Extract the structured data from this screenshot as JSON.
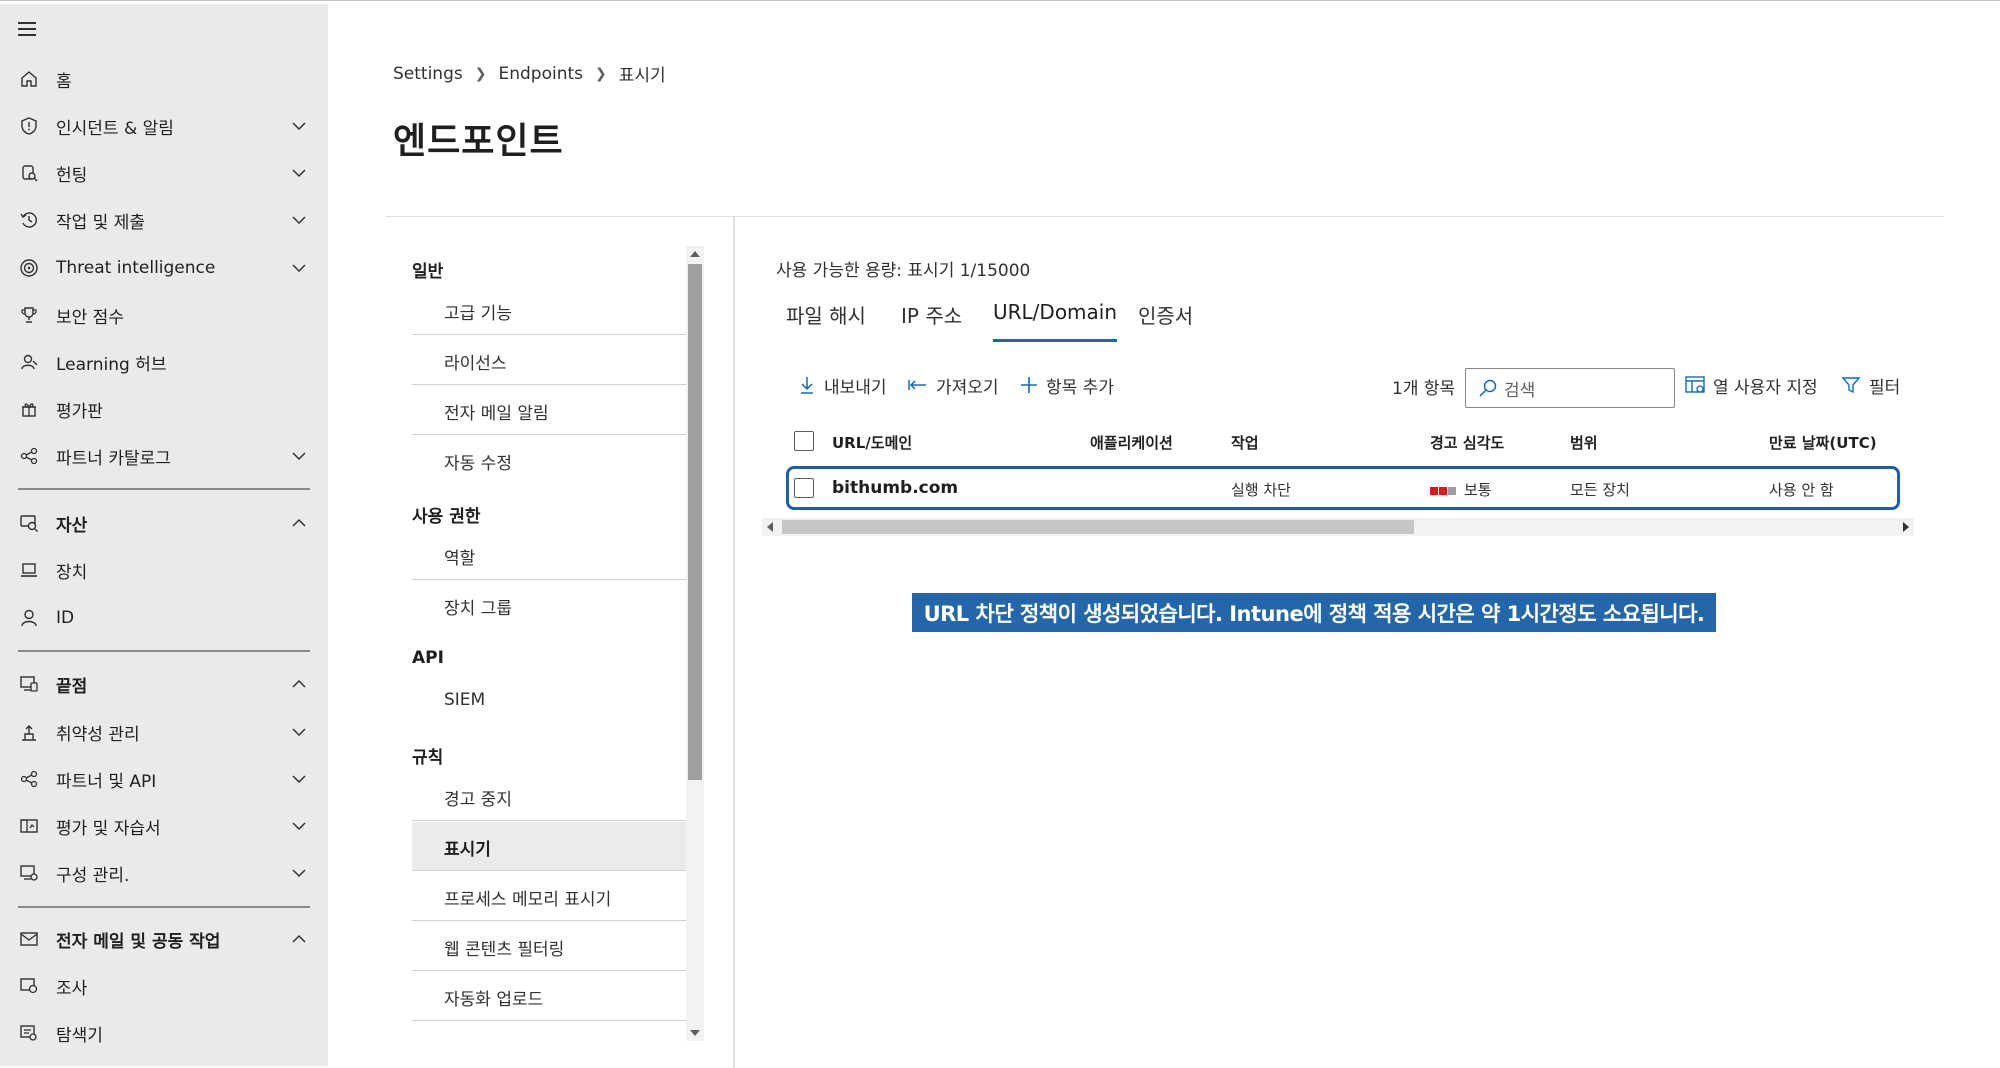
{
  "nav": {
    "items": [
      {
        "label": "홈",
        "icon": "home-icon"
      },
      {
        "label": "인시던트 & 알림",
        "icon": "shield-icon",
        "chevron": "down"
      },
      {
        "label": "헌팅",
        "icon": "hunting-icon",
        "chevron": "down"
      },
      {
        "label": "작업 및 제출",
        "icon": "actions-icon",
        "chevron": "down"
      },
      {
        "label": "Threat intelligence",
        "icon": "threat-intel-icon",
        "chevron": "down"
      },
      {
        "label": "보안 점수",
        "icon": "trophy-icon"
      },
      {
        "label": "Learning 허브",
        "icon": "learning-hub-icon"
      },
      {
        "label": "평가판",
        "icon": "trials-icon"
      },
      {
        "label": "파트너 카탈로그",
        "icon": "partner-icon",
        "chevron": "down"
      },
      {
        "label": "자산",
        "icon": "assets-icon",
        "chevron": "up"
      },
      {
        "label": "장치",
        "icon": "laptop-icon"
      },
      {
        "label": "ID",
        "icon": "person-icon"
      },
      {
        "label": "끝점",
        "icon": "endpoints-icon",
        "chevron": "up"
      },
      {
        "label": "취약성 관리",
        "icon": "vulnerability-icon",
        "chevron": "down"
      },
      {
        "label": "파트너 및 API",
        "icon": "partner-api-icon",
        "chevron": "down"
      },
      {
        "label": "평가 및 자습서",
        "icon": "evaluation-icon",
        "chevron": "down"
      },
      {
        "label": "구성 관리.",
        "icon": "config-icon",
        "chevron": "down"
      },
      {
        "label": "전자 메일 및 공동 작업",
        "icon": "mail-icon",
        "chevron": "up"
      },
      {
        "label": "조사",
        "icon": "investigation-icon"
      },
      {
        "label": "탐색기",
        "icon": "explorer-icon"
      }
    ]
  },
  "breadcrumb": {
    "items": [
      "Settings",
      "Endpoints",
      "표시기"
    ]
  },
  "page_title": "엔드포인트",
  "settings_nav": {
    "groups": [
      {
        "label": "일반",
        "items": [
          "고급 기능",
          "라이선스",
          "전자 메일 알림",
          "자동 수정"
        ]
      },
      {
        "label": "사용 권한",
        "items": [
          "역할",
          "장치 그룹"
        ]
      },
      {
        "label": "API",
        "items": [
          "SIEM"
        ]
      },
      {
        "label": "규칙",
        "items": [
          "경고 중지",
          "표시기",
          "프로세스 메모리 표시기",
          "웹 콘텐츠 필터링",
          "자동화 업로드"
        ]
      }
    ],
    "active": "표시기"
  },
  "capacity": "사용 가능한 용량: 표시기 1/15000",
  "tabs": [
    "파일 해시",
    "IP 주소",
    "URL/Domain",
    "인증서"
  ],
  "active_tab": "URL/Domain",
  "toolbar": {
    "export": "내보내기",
    "import": "가져오기",
    "add": "항목 추가",
    "count": "1개 항목",
    "search_placeholder": "검색",
    "customize_columns": "열 사용자 지정",
    "filter": "필터"
  },
  "table": {
    "headers": [
      "URL/도메인",
      "애플리케이션",
      "작업",
      "경고 심각도",
      "범위",
      "만료 날짜(UTC)"
    ],
    "rows": [
      {
        "url": "bithumb.com",
        "application": "",
        "action": "실행 차단",
        "severity": "보통",
        "scope": "모든 장치",
        "expiry": "사용 안 함"
      }
    ]
  },
  "severity_colors": {
    "active": "#e81123",
    "inactive": "#a19f9d"
  },
  "accent_color": "#0f6cbd",
  "banner": "URL 차단 정책이 생성되었습니다. Intune에 정책 적용 시간은 약 1시간정도 소요됩니다."
}
